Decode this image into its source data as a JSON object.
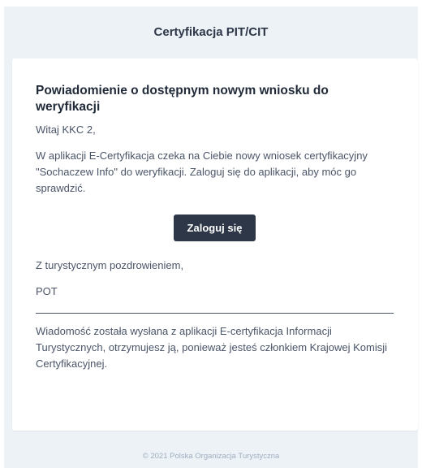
{
  "header": {
    "title": "Certyfikacja PIT/CIT"
  },
  "email": {
    "title": "Powiadomienie o dostępnym nowym wniosku do weryfikacji",
    "greeting": "Witaj KKC 2,",
    "body": "W aplikacji E-Certyfikacja czeka na Ciebie nowy wniosek certyfikacyjny \"Sochaczew Info\" do weryfikacji. Zaloguj się do aplikacji, aby móc go sprawdzić.",
    "button_label": "Zaloguj się",
    "closing": "Z turystycznym pozdrowieniem,",
    "signature": "POT",
    "note": "Wiadomość została wysłana z aplikacji E-certyfikacja Informacji Turystycznych, otrzymujesz ją, ponieważ jesteś członkiem Krajowej Komisji Certyfikacyjnej."
  },
  "footer": {
    "copyright": "© 2021 Polska Organizacja Turystyczna"
  },
  "colors": {
    "background": "#edf2f7",
    "card": "#ffffff",
    "button": "#2d3748",
    "text": "#4a5568"
  }
}
